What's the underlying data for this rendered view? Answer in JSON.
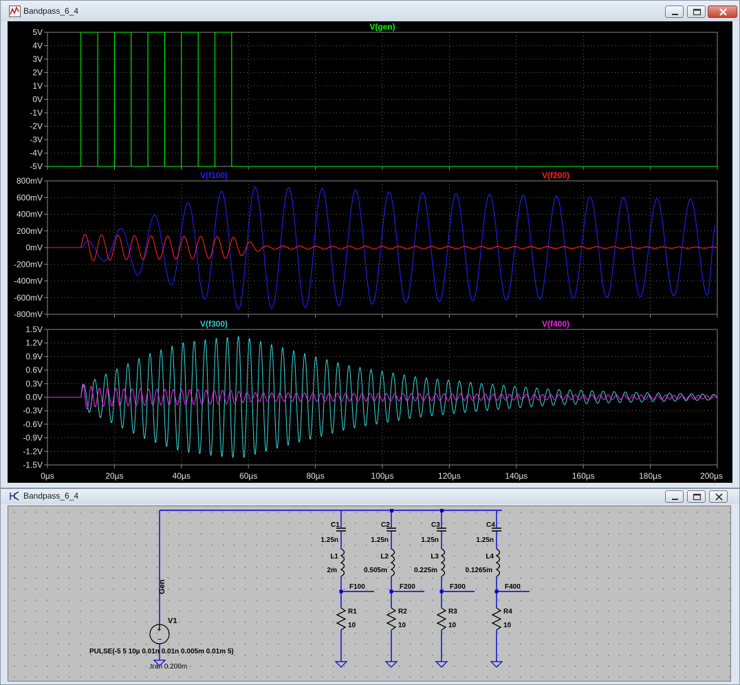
{
  "plot_window": {
    "title": "Bandpass_6_4",
    "icon": "waveform-icon",
    "controls": [
      "minimize-icon",
      "maximize-icon",
      "close-icon"
    ]
  },
  "schematic_window": {
    "title": "Bandpass_6_4",
    "icon": "schematic-icon",
    "controls": [
      "minimize-icon",
      "maximize-icon",
      "close-icon"
    ]
  },
  "colors": {
    "gen": "#00ff00",
    "f100": "#2020ff",
    "f200": "#ff2020",
    "f300": "#33cccc",
    "f400": "#ee22ee",
    "grid": "#8a8a8a",
    "plot_background": "#000000",
    "wire": "#0000cc"
  },
  "chart_data": [
    {
      "type": "line",
      "title": "",
      "xlabel": "",
      "ylabel": "",
      "legend": [
        "V(gen)"
      ],
      "x_range": [
        0,
        200
      ],
      "x_unit": "µs",
      "ylim": [
        -5,
        5
      ],
      "y_ticks": [
        "5V",
        "4V",
        "3V",
        "2V",
        "1V",
        "0V",
        "-1V",
        "-2V",
        "-3V",
        "-4V",
        "-5V"
      ],
      "grid": true,
      "series": [
        {
          "name": "V(gen)",
          "color": "#00ff00",
          "kind": "pulse",
          "low": -5,
          "high": 5,
          "start_us": 10,
          "half_period_us": 5,
          "cycles": 5,
          "x": [
            0,
            10,
            10,
            15,
            15,
            20,
            20,
            25,
            25,
            30,
            30,
            35,
            35,
            40,
            40,
            45,
            45,
            50,
            50,
            55,
            55,
            200
          ],
          "y": [
            -5,
            -5,
            5,
            5,
            -5,
            -5,
            5,
            5,
            -5,
            -5,
            5,
            5,
            -5,
            -5,
            5,
            5,
            -5,
            -5,
            5,
            5,
            -5,
            -5
          ]
        }
      ]
    },
    {
      "type": "line",
      "title": "",
      "xlabel": "",
      "ylabel": "",
      "legend": [
        "V(f100)",
        "V(f200)"
      ],
      "x_range": [
        0,
        200
      ],
      "x_unit": "µs",
      "ylim": [
        -800,
        800
      ],
      "y_unit": "mV",
      "y_ticks": [
        "800mV",
        "600mV",
        "400mV",
        "200mV",
        "0mV",
        "-200mV",
        "-400mV",
        "-600mV",
        "-800mV"
      ],
      "grid": true,
      "series": [
        {
          "name": "V(f100)",
          "color": "#2020ff",
          "kind": "ringing",
          "start_us": 10,
          "period_us": 9.85,
          "peak_times_us": [
            12,
            22,
            32,
            42,
            52,
            62,
            72,
            82,
            92,
            102,
            112,
            122,
            132,
            142,
            152,
            162,
            172,
            182,
            192,
            199.5
          ],
          "peak_values_mV": [
            80,
            230,
            390,
            540,
            680,
            730,
            720,
            710,
            690,
            670,
            660,
            650,
            640,
            630,
            620,
            610,
            600,
            590,
            580,
            270
          ],
          "trough_times_us": [
            17,
            27,
            37,
            47,
            57,
            67,
            77,
            87,
            97,
            107,
            117,
            127,
            137,
            147,
            157,
            167,
            177,
            187,
            197
          ],
          "trough_values_mV": [
            -160,
            -330,
            -450,
            -620,
            -740,
            -730,
            -720,
            -700,
            -680,
            -660,
            -650,
            -640,
            -630,
            -620,
            -610,
            -600,
            -590,
            -580,
            -570
          ]
        },
        {
          "name": "V(f200)",
          "color": "#ff2020",
          "kind": "ringing",
          "start_us": 10,
          "period_us": 4.93,
          "amplitude_mV": [
            [
              10,
              160
            ],
            [
              30,
              140
            ],
            [
              55,
              130
            ],
            [
              65,
              20
            ],
            [
              200,
              8
            ]
          ]
        }
      ]
    },
    {
      "type": "line",
      "title": "",
      "xlabel": "",
      "ylabel": "",
      "legend": [
        "V(f300)",
        "V(f400)"
      ],
      "x_range": [
        0,
        200
      ],
      "x_unit": "µs",
      "x_ticks": [
        "0µs",
        "20µs",
        "40µs",
        "60µs",
        "80µs",
        "100µs",
        "120µs",
        "140µs",
        "160µs",
        "180µs",
        "200µs"
      ],
      "ylim": [
        -1.5,
        1.5
      ],
      "y_ticks": [
        "1.5V",
        "1.2V",
        "0.9V",
        "0.6V",
        "0.3V",
        "0.0V",
        "-0.3V",
        "-0.6V",
        "-0.9V",
        "-1.2V",
        "-1.5V"
      ],
      "grid": true,
      "series": [
        {
          "name": "V(f300)",
          "color": "#33cccc",
          "kind": "ringing",
          "start_us": 10,
          "period_us": 3.3,
          "amplitude_V": [
            [
              10,
              0.25
            ],
            [
              20,
              0.6
            ],
            [
              30,
              0.95
            ],
            [
              40,
              1.2
            ],
            [
              50,
              1.3
            ],
            [
              58,
              1.35
            ],
            [
              70,
              1.1
            ],
            [
              90,
              0.7
            ],
            [
              110,
              0.45
            ],
            [
              130,
              0.3
            ],
            [
              150,
              0.18
            ],
            [
              170,
              0.12
            ],
            [
              200,
              0.06
            ]
          ]
        },
        {
          "name": "V(f400)",
          "color": "#ee22ee",
          "kind": "ringing",
          "start_us": 10,
          "period_us": 2.45,
          "amplitude_V": [
            [
              10,
              0.3
            ],
            [
              15,
              0.2
            ],
            [
              55,
              0.15
            ],
            [
              60,
              0.1
            ],
            [
              200,
              0.04
            ]
          ]
        }
      ]
    }
  ],
  "schematic": {
    "source": {
      "ref": "V1",
      "node": "Gen",
      "value": "PULSE(-5 5 10µ 0.01n 0.01n 0.005m 0.01m 5)",
      "directive": ".tran 0.200m"
    },
    "branches": [
      {
        "cap": "C1",
        "cap_val": "1.25n",
        "ind": "L1",
        "ind_val": "2m",
        "node": "F100",
        "res": "R1",
        "res_val": "10"
      },
      {
        "cap": "C2",
        "cap_val": "1.25n",
        "ind": "L2",
        "ind_val": "0.505m",
        "node": "F200",
        "res": "R2",
        "res_val": "10"
      },
      {
        "cap": "C3",
        "cap_val": "1.25n",
        "ind": "L3",
        "ind_val": "0.225m",
        "node": "F300",
        "res": "R3",
        "res_val": "10"
      },
      {
        "cap": "C4",
        "cap_val": "1.25n",
        "ind": "L4",
        "ind_val": "0.1265m",
        "node": "F400",
        "res": "R4",
        "res_val": "10"
      }
    ]
  }
}
